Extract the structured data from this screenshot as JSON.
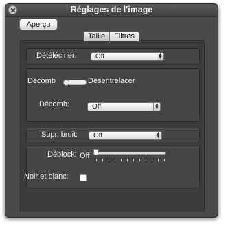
{
  "window": {
    "title": "Réglages de l'image"
  },
  "toolbar": {
    "apercu_label": "Aperçu"
  },
  "tabs": [
    {
      "label": "Taille",
      "selected": true
    },
    {
      "label": "Filtres",
      "selected": false
    }
  ],
  "deinterlace": {
    "label": "Détéléciner:",
    "value": "Off"
  },
  "decomb": {
    "left_label": "Décomb",
    "right_label": "Désentrelacer",
    "popup_label": "Décomb:",
    "popup_value": "Off"
  },
  "denoise": {
    "label": "Supr. bruit:",
    "value": "Off"
  },
  "deblock": {
    "label": "Déblock:",
    "value_text": "Off",
    "slider_fraction": 0.0
  },
  "grayscale": {
    "label": "Noir et blanc:",
    "checked": false
  }
}
